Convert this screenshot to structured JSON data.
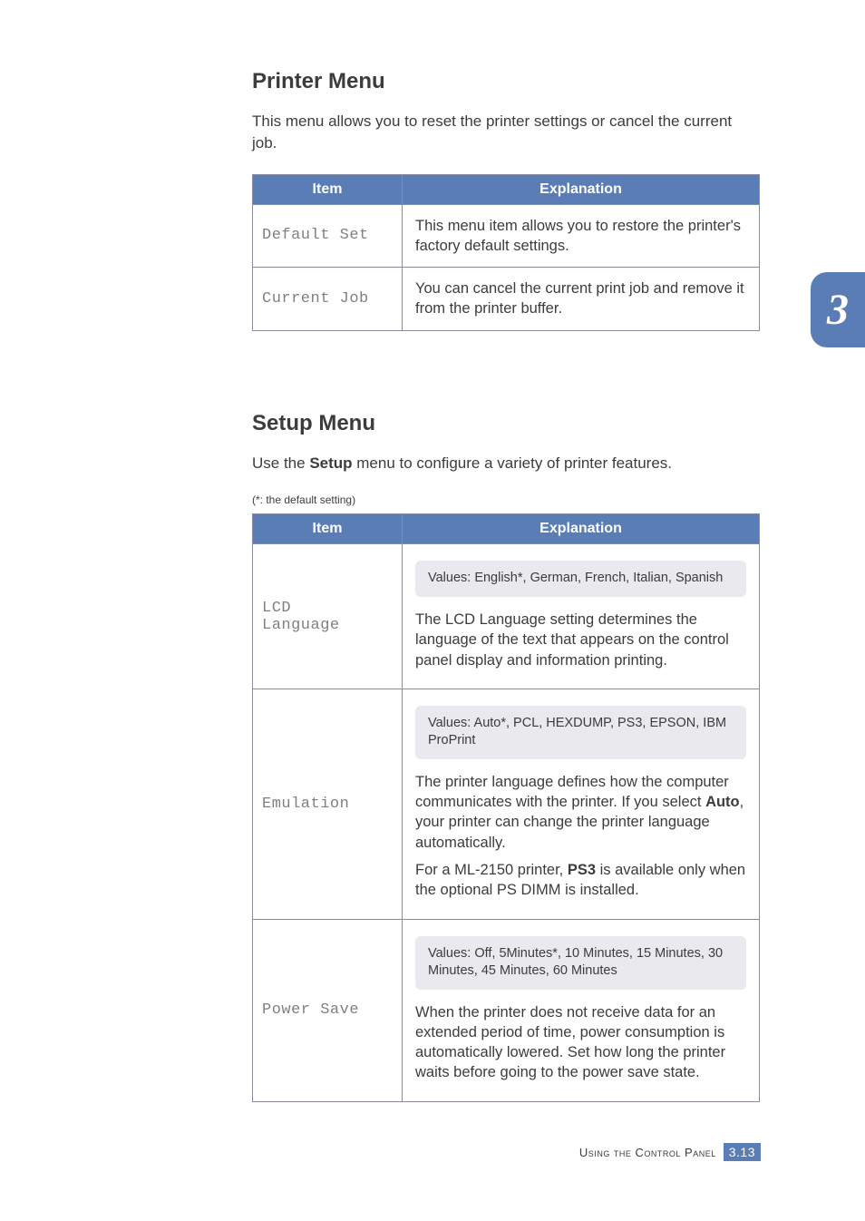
{
  "sections": {
    "printer": {
      "title": "Printer Menu",
      "intro": "This menu allows you to reset the printer settings or cancel the current job.",
      "headers": {
        "item": "Item",
        "expl": "Explanation"
      },
      "rows": [
        {
          "item": "Default Set",
          "expl": "This menu item allows you to restore the printer's factory default settings."
        },
        {
          "item": "Current Job",
          "expl": "You can cancel the current print job and remove it from the printer buffer."
        }
      ]
    },
    "setup": {
      "title": "Setup Menu",
      "intro_pre": "Use the ",
      "intro_bold": "Setup",
      "intro_post": " menu to configure a variety of printer features.",
      "footnote": "(*: the default setting)",
      "headers": {
        "item": "Item",
        "expl": "Explanation"
      },
      "rows": {
        "lcd": {
          "item": "LCD\nLanguage",
          "values": "Values: English*, German, French, Italian, Spanish",
          "body": "The LCD Language setting determines the language of the text that appears on the control panel display and information printing."
        },
        "emulation": {
          "item": "Emulation",
          "values": "Values: Auto*, PCL, HEXDUMP, PS3, EPSON, IBM ProPrint",
          "body1_pre": "The printer language defines how the computer communicates with the printer. If you select ",
          "body1_bold": "Auto",
          "body1_post": ", your printer can change the printer language automatically.",
          "body2_pre": "For a ML-2150 printer, ",
          "body2_bold": "PS3",
          "body2_post": " is available only when the optional PS DIMM is installed."
        },
        "power": {
          "item": "Power Save",
          "values": "Values: Off,  5Minutes*, 10 Minutes, 15 Minutes, 30 Minutes, 45 Minutes, 60 Minutes",
          "body": "When the printer does not receive data for an extended period of time, power consumption is automatically lowered. Set how long the printer waits before going to the power save state."
        }
      }
    }
  },
  "chapter_tab": "3",
  "footer": {
    "text": "Using the Control Panel",
    "chapter": "3.",
    "page": "13"
  }
}
